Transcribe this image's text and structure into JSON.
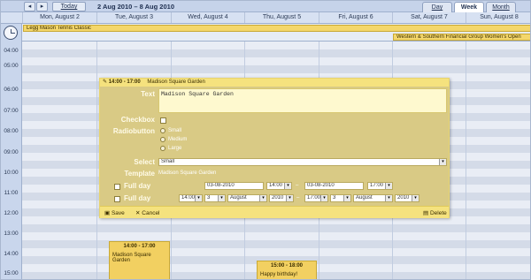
{
  "nav": {
    "prev": "◂",
    "next": "▸",
    "today": "Today",
    "range": "2 Aug 2010 – 8 Aug 2010",
    "tabs": {
      "day": "Day",
      "week": "Week",
      "month": "Month"
    },
    "active_tab": "Week"
  },
  "days": [
    "Mon, August 2",
    "Tue, August 3",
    "Wed, August 4",
    "Thu, August 5",
    "Fri, August 6",
    "Sat, August 7",
    "Sun, August 8"
  ],
  "all_day_events": [
    {
      "title": "Legg Mason Tennis Classic"
    },
    {
      "title": "Western & Southern Financial Group Women's Open"
    }
  ],
  "hours": [
    "04:00",
    "05:00",
    "06:00",
    "07:00",
    "08:00",
    "09:00",
    "10:00",
    "11:00",
    "12:00",
    "13:00",
    "14:00",
    "15:00"
  ],
  "events": [
    {
      "time": "14:00 - 17:00",
      "text": "Madison Square Garden"
    },
    {
      "time": "15:00 - 18:00",
      "text": "Happy birthday!"
    }
  ],
  "editor": {
    "header_time": "14:00 - 17:00",
    "header_title": "Madison Square Garden",
    "labels": {
      "text": "Text",
      "checkbox": "Checkbox",
      "radio": "Radiobutton",
      "select": "Select",
      "template": "Template",
      "full_day_1": "Full day",
      "full_day_2": "Full day"
    },
    "text_value": "Madison Square Garden",
    "radio_options": [
      "Small",
      "Medium",
      "Large"
    ],
    "select_value": "Small",
    "template_value": "Madison Square Garden",
    "row1": {
      "start_date": "03-08-2010",
      "start_time": "14:00",
      "sep": "–",
      "end_date": "03-08-2010",
      "end_time": "17:00"
    },
    "row2": {
      "start_time": "14:00",
      "start_day": "3",
      "start_month": "August",
      "start_year": "2010",
      "sep": "–",
      "end_time": "17:00",
      "end_day": "3",
      "end_month": "August",
      "end_year": "2010"
    },
    "buttons": {
      "save": "Save",
      "cancel": "Cancel",
      "delete": "Delete"
    }
  },
  "colors": {
    "event": "#f2d061",
    "editor": "#d9ca85",
    "header": "#c6d3ea"
  }
}
